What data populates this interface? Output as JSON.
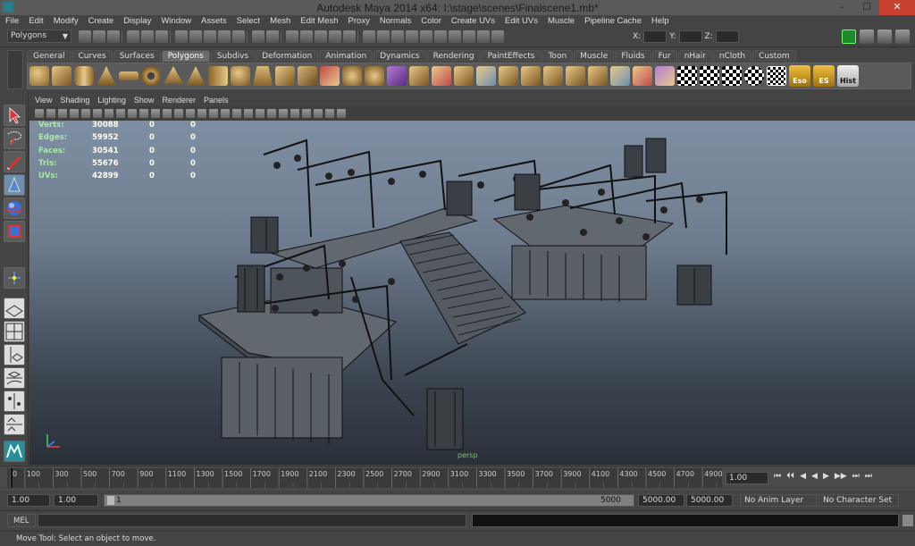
{
  "window": {
    "title": "Autodesk Maya 2014 x64: I:\\stage\\scenes\\Finalscene1.mb*",
    "minimize": "–",
    "maximize": "☐",
    "close": "✕"
  },
  "menu": [
    "File",
    "Edit",
    "Modify",
    "Create",
    "Display",
    "Window",
    "Assets",
    "Select",
    "Mesh",
    "Edit Mesh",
    "Proxy",
    "Normals",
    "Color",
    "Create UVs",
    "Edit UVs",
    "Muscle",
    "Pipeline Cache",
    "Help"
  ],
  "status": {
    "mode": "Polygons",
    "x_label": "X:",
    "y_label": "Y:",
    "z_label": "Z:"
  },
  "shelf": {
    "tabs": [
      "General",
      "Curves",
      "Surfaces",
      "Polygons",
      "Subdivs",
      "Deformation",
      "Animation",
      "Dynamics",
      "Rendering",
      "PaintEffects",
      "Toon",
      "Muscle",
      "Fluids",
      "Fur",
      "nHair",
      "nCloth",
      "Custom"
    ],
    "active_tab": "Polygons",
    "labeled_icons": [
      "Eso",
      "ES",
      "Hist"
    ]
  },
  "panel": {
    "menu": [
      "View",
      "Shading",
      "Lighting",
      "Show",
      "Renderer",
      "Panels"
    ]
  },
  "hud": {
    "rows": [
      {
        "label": "Verts:",
        "total": "30088",
        "sel": "0",
        "comp": "0"
      },
      {
        "label": "Edges:",
        "total": "59952",
        "sel": "0",
        "comp": "0"
      },
      {
        "label": "Faces:",
        "total": "30541",
        "sel": "0",
        "comp": "0"
      },
      {
        "label": "Tris:",
        "total": "55676",
        "sel": "0",
        "comp": "0"
      },
      {
        "label": "UVs:",
        "total": "42899",
        "sel": "0",
        "comp": "0"
      }
    ],
    "camera": "persp"
  },
  "timeline": {
    "ticks": [
      "0",
      "100",
      "300",
      "500",
      "700",
      "900",
      "1100",
      "1300",
      "1500",
      "1700",
      "1900",
      "2100",
      "2300",
      "2500",
      "2700",
      "2900",
      "3100",
      "3300",
      "3500",
      "3700",
      "3900",
      "4100",
      "4300",
      "4500",
      "4700",
      "4900"
    ],
    "current_frame": "1.00",
    "playback_icons": [
      "⏮",
      "⏴⏴",
      "◀",
      "◀",
      "▶",
      "▶▶",
      "⏭",
      "⏭"
    ]
  },
  "range": {
    "start": "1.00",
    "playstart": "1.00",
    "slider_start": "1",
    "slider_end": "5000",
    "playend": "5000.00",
    "end": "5000.00",
    "anim_layer": "No Anim Layer",
    "char_set": "No Character Set"
  },
  "mel": {
    "label": "MEL"
  },
  "help": "Move Tool: Select an object to move."
}
